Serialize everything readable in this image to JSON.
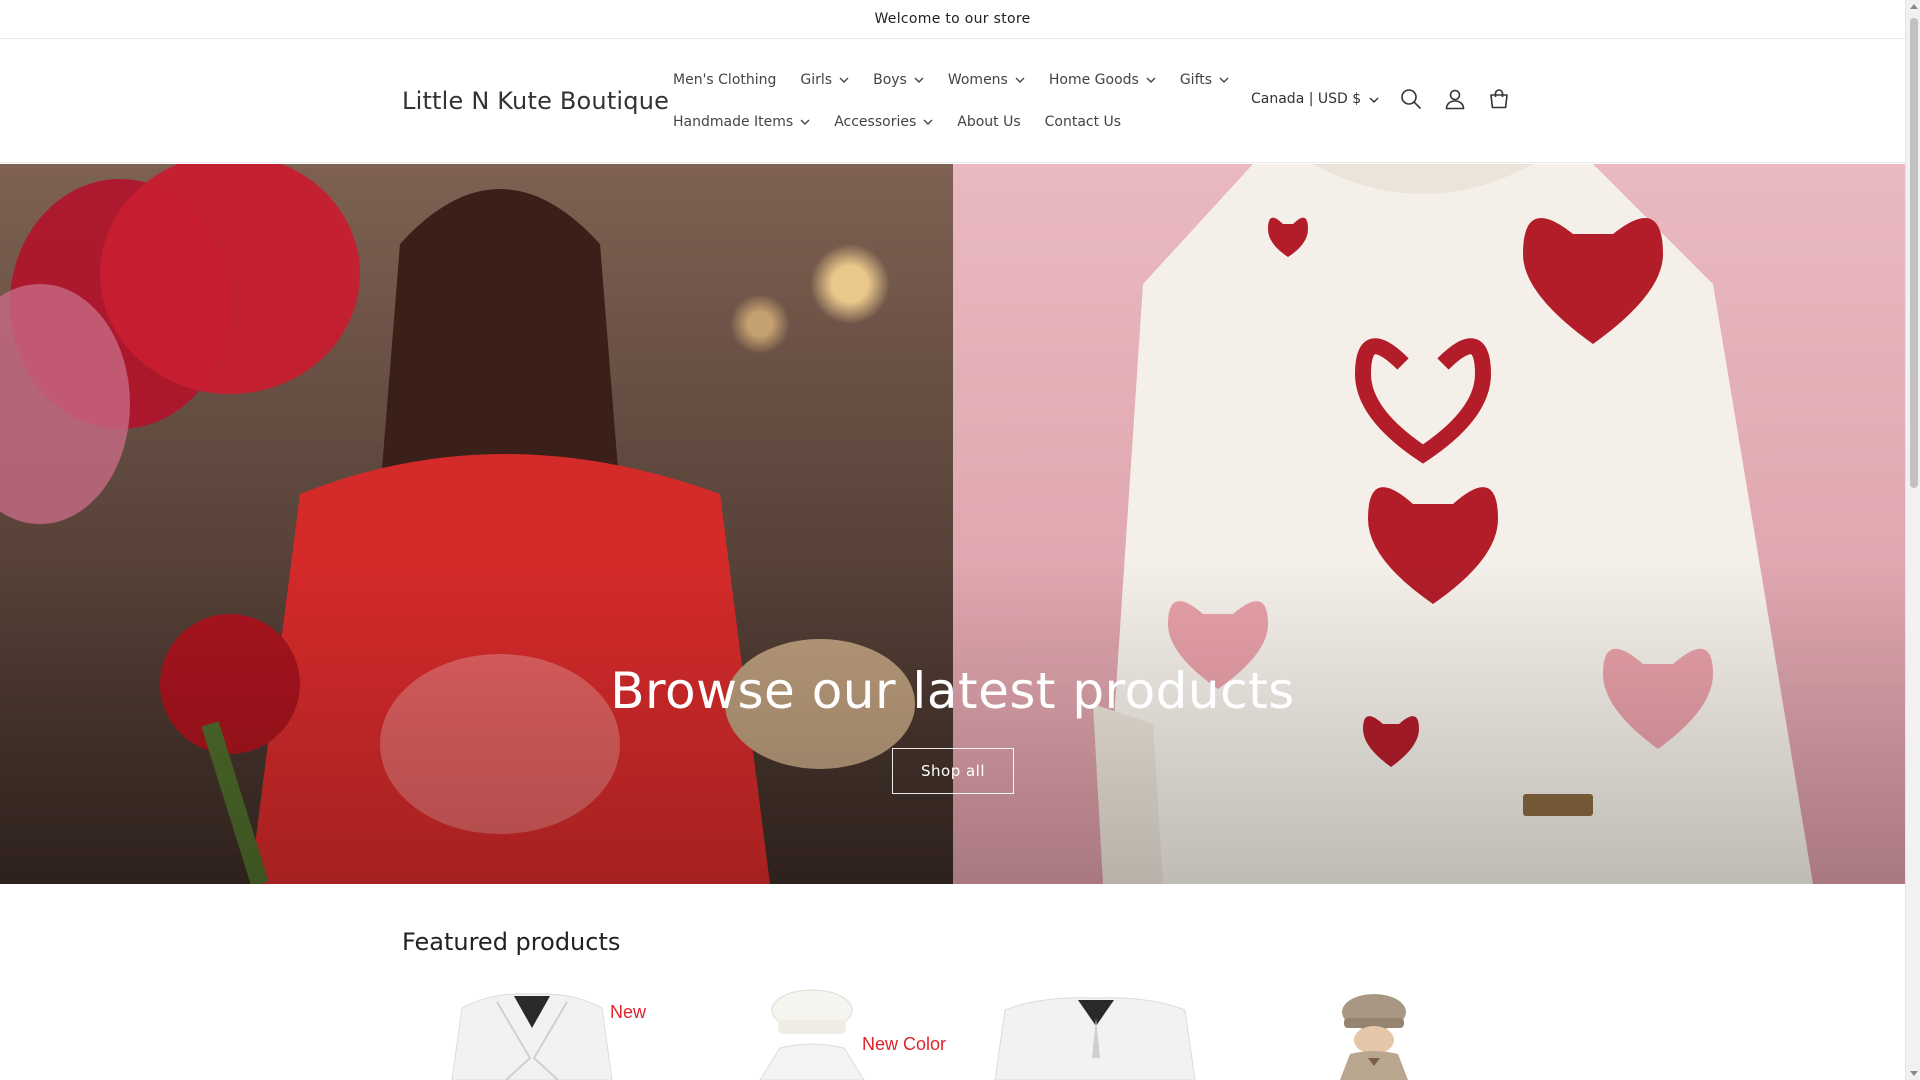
{
  "announcement": {
    "text": "Welcome to our store"
  },
  "header": {
    "logo": "Little N Kute Boutique",
    "nav_row1": [
      {
        "label": "Men's Clothing",
        "has_dropdown": false
      },
      {
        "label": "Girls",
        "has_dropdown": true
      },
      {
        "label": "Boys",
        "has_dropdown": true
      },
      {
        "label": "Womens",
        "has_dropdown": true
      },
      {
        "label": "Home Goods",
        "has_dropdown": true
      },
      {
        "label": "Gifts",
        "has_dropdown": true
      }
    ],
    "nav_row2": [
      {
        "label": "Handmade Items",
        "has_dropdown": true
      },
      {
        "label": "Accessories",
        "has_dropdown": true
      },
      {
        "label": "About Us",
        "has_dropdown": false
      },
      {
        "label": "Contact Us",
        "has_dropdown": false
      }
    ],
    "currency": "Canada | USD $",
    "icons": [
      "search-icon",
      "account-icon",
      "cart-icon"
    ]
  },
  "hero": {
    "heading": "Browse our latest products",
    "button_label": "Shop all"
  },
  "featured": {
    "title": "Featured products",
    "products": [
      {
        "badge": "New"
      },
      {
        "badge": "New Color"
      },
      {
        "badge": ""
      },
      {
        "badge": ""
      }
    ]
  },
  "colors": {
    "badge_red": "#e0242b",
    "hero_pink": "#e9b9bf"
  }
}
